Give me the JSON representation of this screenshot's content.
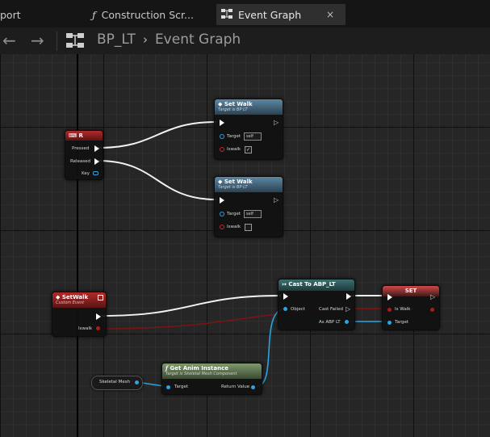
{
  "tabs": [
    {
      "label": "port"
    },
    {
      "label": "Construction Scr...",
      "icon": "function-icon"
    },
    {
      "label": "Event Graph",
      "icon": "graph-icon",
      "active": true
    }
  ],
  "tab_close": "×",
  "breadcrumb": {
    "blueprint": "BP_LT",
    "separator": "›",
    "graph": "Event Graph"
  },
  "nodes": {
    "set_walk_1": {
      "title": "Set Walk",
      "subtitle": "Target is BP LT",
      "target_label": "Target",
      "target_value": "self",
      "param_label": "Iswalk",
      "param_checked": "✓"
    },
    "set_walk_2": {
      "title": "Set Walk",
      "subtitle": "Target is BP LT",
      "target_label": "Target",
      "target_value": "self",
      "param_label": "Iswalk",
      "param_checked": ""
    },
    "r_key": {
      "title": "R",
      "pressed": "Pressed",
      "released": "Released",
      "key": "Key"
    },
    "custom_event": {
      "title": "SetWalk",
      "subtitle": "Custom Event",
      "param": "Iswalk"
    },
    "cast": {
      "title": "Cast To ABP_LT",
      "object": "Object",
      "cast_failed": "Cast Failed",
      "output": "As ABP LT"
    },
    "set": {
      "title": "SET",
      "is_walk": "Is Walk",
      "target": "Target"
    },
    "get_anim": {
      "title": "Get Anim Instance",
      "subtitle": "Target is Skeletal Mesh Component",
      "target": "Target",
      "return_value": "Return Value"
    },
    "skeletal_mesh": {
      "label": "Skeletal Mesh"
    }
  },
  "colors": {
    "exec": "#ffffff",
    "object_pin": "#2ca3e4",
    "bool_pin": "#b11919"
  }
}
